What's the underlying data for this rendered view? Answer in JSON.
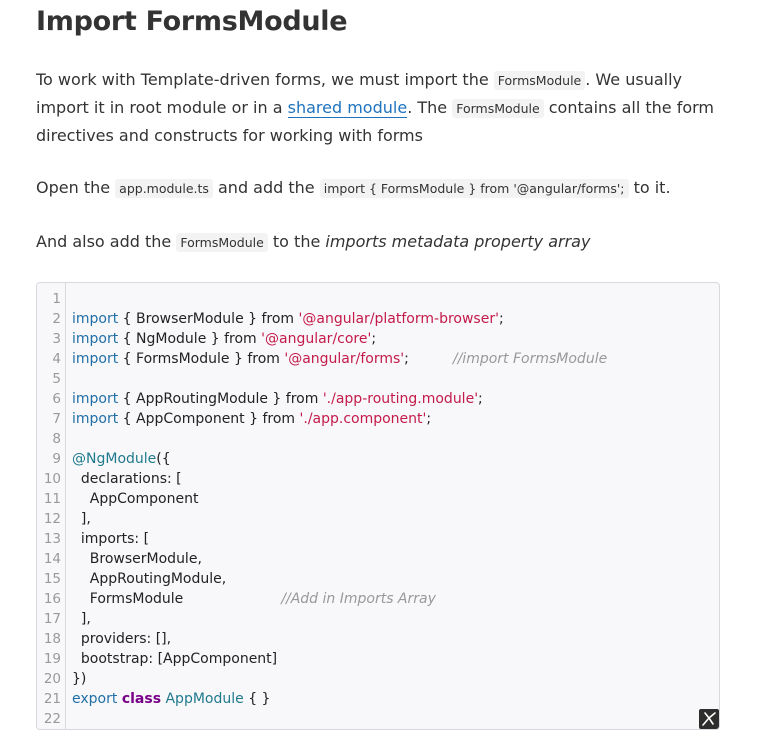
{
  "heading": "Import FormsModule",
  "para1": {
    "t1": "To work with Template-driven forms, we must import the ",
    "c1": "FormsModule",
    "t2": ". We usually import it in root module or in a ",
    "link": "shared module",
    "t3": ". The ",
    "c2": "FormsModule",
    "t4": " contains all the form directives and constructs for working with forms"
  },
  "para2": {
    "t1": "Open the ",
    "c1": "app.module.ts",
    "t2": " and add the ",
    "c2": "import { FormsModule } from '@angular/forms';",
    "t3": " to it."
  },
  "para3": {
    "t1": "And also add the ",
    "c1": "FormsModule",
    "t2": " to the ",
    "em": "imports metadata property array"
  },
  "code": {
    "line_numbers": [
      "1",
      "2",
      "3",
      "4",
      "5",
      "6",
      "7",
      "8",
      "9",
      "10",
      "11",
      "12",
      "13",
      "14",
      "15",
      "16",
      "17",
      "18",
      "19",
      "20",
      "21",
      "22"
    ],
    "l2": {
      "kw": "import",
      "mid": " { BrowserModule } from ",
      "str": "'@angular/platform-browser'",
      "end": ";"
    },
    "l3": {
      "kw": "import",
      "mid": " { NgModule } from ",
      "str": "'@angular/core'",
      "end": ";"
    },
    "l4": {
      "kw": "import",
      "mid": " { FormsModule } from ",
      "str": "'@angular/forms'",
      "end": ";",
      "cm": "//import FormsModule"
    },
    "l6": {
      "kw": "import",
      "mid": " { AppRoutingModule } from ",
      "str": "'./app-routing.module'",
      "end": ";"
    },
    "l7": {
      "kw": "import",
      "mid": " { AppComponent } from ",
      "str": "'./app.component'",
      "end": ";"
    },
    "l9": {
      "deco": "@NgModule",
      "rest": "({"
    },
    "l10": "  declarations: [",
    "l11": "    AppComponent",
    "l12": "  ],",
    "l13": "  imports: [",
    "l14": "    BrowserModule,",
    "l15": "    AppRoutingModule,",
    "l16": {
      "text": "    FormsModule",
      "cm": "//Add in Imports Array"
    },
    "l17": "  ],",
    "l18": "  providers: [],",
    "l19": "  bootstrap: [AppComponent]",
    "l20": "})",
    "l21": {
      "kw": "export",
      "cls_kw": "class",
      "name": "AppModule",
      "rest": " { }"
    }
  },
  "icons": {
    "corner": "logo-icon"
  }
}
